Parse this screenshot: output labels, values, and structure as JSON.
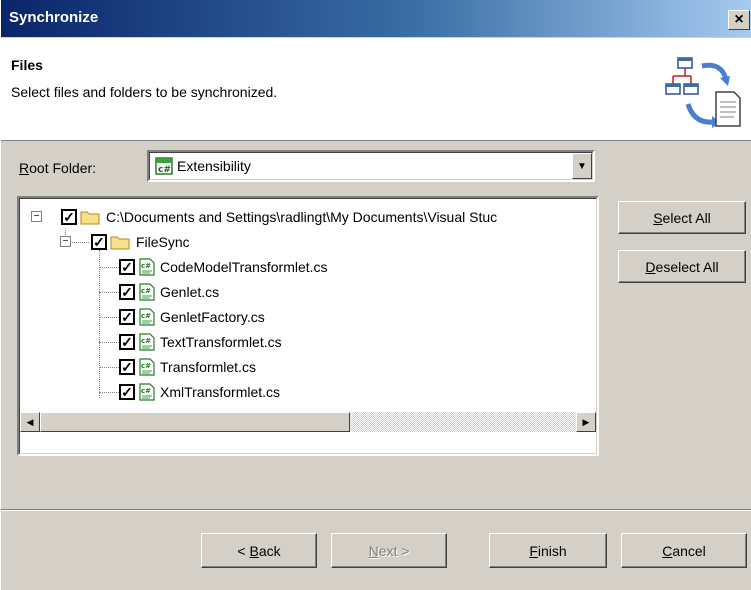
{
  "window": {
    "title": "Synchronize",
    "close_glyph": "×"
  },
  "header": {
    "title": "Files",
    "subtitle": "Select files and folders to be synchronized.",
    "icon": "synchronize-icon"
  },
  "root_folder": {
    "label_mnemonic": "R",
    "label_rest": "oot Folder:",
    "selected_value": "Extensibility",
    "icon": "csharp-project-icon"
  },
  "tree": {
    "root": {
      "label": "C:\\Documents and Settings\\radlingt\\My Documents\\Visual Stuc",
      "checked": true,
      "expanded": true
    },
    "folder": {
      "label": "FileSync",
      "checked": true,
      "expanded": true
    },
    "files": [
      {
        "label": "CodeModelTransformlet.cs",
        "checked": true
      },
      {
        "label": "Genlet.cs",
        "checked": true
      },
      {
        "label": "GenletFactory.cs",
        "checked": true
      },
      {
        "label": "TextTransformlet.cs",
        "checked": true
      },
      {
        "label": "Transformlet.cs",
        "checked": true
      },
      {
        "label": "XmlTransformlet.cs",
        "checked": true
      }
    ]
  },
  "buttons": {
    "select_all": {
      "mnemonic": "S",
      "rest": "elect All"
    },
    "deselect_all": {
      "mnemonic": "D",
      "rest": "eselect All"
    },
    "back": {
      "prefix": "< ",
      "mnemonic": "B",
      "rest": "ack"
    },
    "next": {
      "mnemonic": "N",
      "rest": "ext >"
    },
    "finish": {
      "mnemonic": "F",
      "rest": "inish"
    },
    "cancel": {
      "mnemonic": "C",
      "rest": "ancel"
    }
  }
}
